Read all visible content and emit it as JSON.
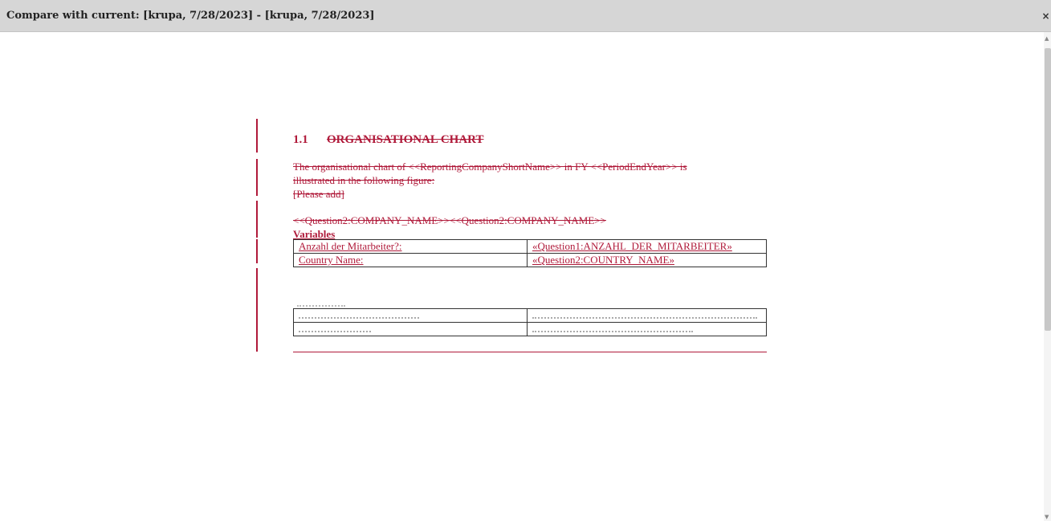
{
  "window": {
    "title": "Compare with current: [krupa, 7/28/2023] - [krupa, 7/28/2023]",
    "close_icon": "×"
  },
  "document": {
    "heading": {
      "number": "1.1",
      "text": "ORGANISATIONAL CHART"
    },
    "paragraph_line1": "The organisational chart of <<ReportingCompanyShortName>> in FY <<PeriodEndYear>> is",
    "paragraph_line2": "illustrated in the following figure:",
    "paragraph_line3": "[Please add]",
    "company_line": "<<Question2:COMPANY_NAME>><<Question2:COMPANY_NAME>>",
    "variables_title": "Variables",
    "variables": [
      {
        "label": "Anzahl der Mitarbeiter?:",
        "value": "«Question1:ANZAHL_DER_MITARBEITER»"
      },
      {
        "label": "Country Name:",
        "value": "«Question2:COUNTRY_NAME»"
      }
    ],
    "change_color": "#b01a3a"
  }
}
